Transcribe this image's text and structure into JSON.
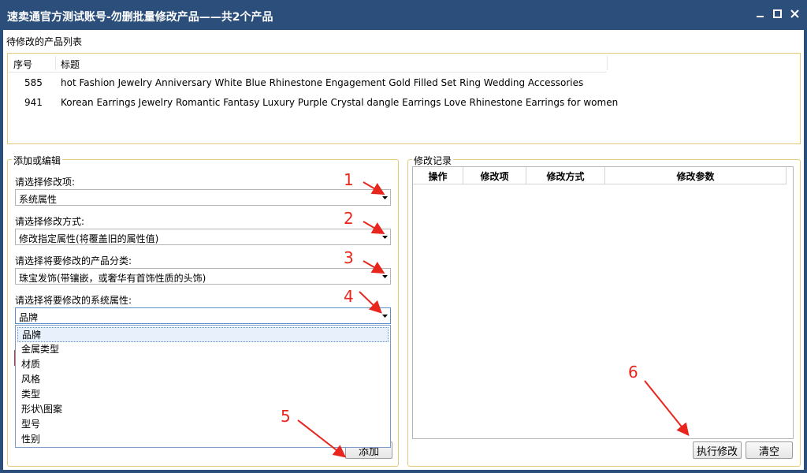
{
  "window": {
    "title": "速卖通官方测试账号-勿删批量修改产品——共2个产品",
    "controls": [
      "minimize-icon",
      "maximize-icon",
      "close-icon"
    ]
  },
  "product_list": {
    "section_label": "待修改的产品列表",
    "columns": [
      "序号",
      "标题"
    ],
    "rows": [
      {
        "index": "585",
        "title": "hot Fashion Jewelry Anniversary White Blue Rhinestone Engagement Gold Filled Set Ring Wedding Accessories"
      },
      {
        "index": "941",
        "title": "Korean Earrings Jewelry Romantic Fantasy Luxury Purple Crystal dangle Earrings Love Rhinestone Earrings for women"
      }
    ]
  },
  "edit_panel": {
    "legend": "添加或编辑",
    "field1": {
      "label": "请选择修改项:",
      "value": "系统属性"
    },
    "field2": {
      "label": "请选择修改方式:",
      "value": "修改指定属性(将覆盖旧的属性值)"
    },
    "field3": {
      "label": "请选择将要修改的产品分类:",
      "value": "珠宝发饰(带镶嵌，或奢华有首饰性质的头饰)"
    },
    "field4": {
      "label": "请选择将要修改的系统属性:",
      "value": "品牌"
    },
    "dropdown_options": [
      "品牌",
      "金属类型",
      "材质",
      "风格",
      "类型",
      "形状\\图案",
      "型号",
      "性别"
    ],
    "add_button": "添加"
  },
  "log_panel": {
    "legend": "修改记录",
    "columns": [
      "操作",
      "修改项",
      "修改方式",
      "修改参数"
    ],
    "execute_button": "执行修改",
    "clear_button": "清空"
  },
  "annotations": [
    "1",
    "2",
    "3",
    "4",
    "5",
    "6"
  ],
  "colors": {
    "titlebar": "#2b4f7a",
    "group_border": "#e2c97a",
    "annotation": "#e8261e"
  }
}
